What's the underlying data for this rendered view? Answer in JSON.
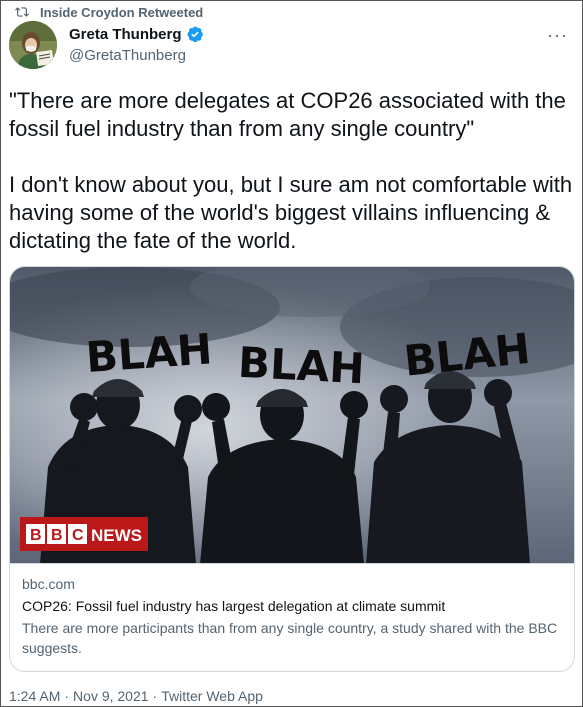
{
  "retweet": {
    "label": "Inside Croydon Retweeted",
    "icon": "retweet-icon"
  },
  "author": {
    "name": "Greta Thunberg",
    "handle": "@GretaThunberg",
    "verified": true,
    "verified_color": "#1d9bf0"
  },
  "tweet": {
    "text": "\"There are more delegates at COP26 associated with the fossil fuel industry than from any single country\"\n\nI don't know about you, but I sure am not comfortable with having some of the world's biggest villains influencing & dictating the fate of the world."
  },
  "card": {
    "image_signs": [
      "BLAH",
      "BLAH",
      "BLAH"
    ],
    "brand_letters": [
      "B",
      "B",
      "C"
    ],
    "brand_word": "NEWS",
    "brand_color": "#bb1919",
    "domain": "bbc.com",
    "title": "COP26: Fossil fuel industry has largest delegation at climate summit",
    "description": "There are more participants than from any single country, a study shared with the BBC suggests."
  },
  "meta": {
    "time": "1:24 AM",
    "date": "Nov 9, 2021",
    "source": "Twitter Web App",
    "separator": "·"
  },
  "colors": {
    "text_primary": "#0f1419",
    "text_secondary": "#536471",
    "border": "#cfd9de"
  }
}
